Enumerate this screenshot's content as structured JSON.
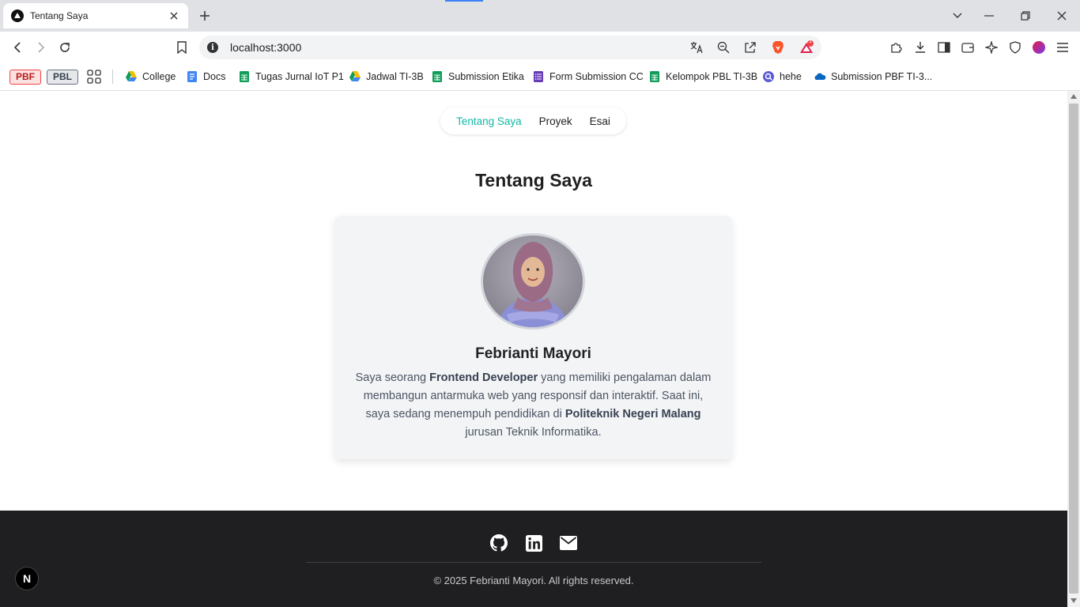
{
  "tab": {
    "title": "Tentang Saya"
  },
  "omnibox": {
    "url": "localhost:3000",
    "info_glyph": "i",
    "brave_badge": "1"
  },
  "bookmarks": {
    "pinned": [
      {
        "label": "PBF",
        "color": "#ef4444"
      },
      {
        "label": "PBL",
        "color": "#6b7280"
      }
    ],
    "items": [
      {
        "label": "College",
        "icon": "google-drive-icon"
      },
      {
        "label": "Docs",
        "icon": "google-docs-icon"
      },
      {
        "label": "Tugas Jurnal IoT P1",
        "icon": "google-sheets-icon"
      },
      {
        "label": "Jadwal TI-3B",
        "icon": "google-drive-icon"
      },
      {
        "label": "Submission Etika",
        "icon": "google-sheets-icon"
      },
      {
        "label": "Form Submission CC",
        "icon": "google-forms-icon"
      },
      {
        "label": "Kelompok PBL TI-3B",
        "icon": "google-sheets-icon"
      },
      {
        "label": "hehe",
        "icon": "search-app-icon"
      },
      {
        "label": "Submission PBF TI-3...",
        "icon": "onedrive-icon"
      }
    ]
  },
  "nav": {
    "links": [
      {
        "label": "Tentang Saya",
        "active": true
      },
      {
        "label": "Proyek",
        "active": false
      },
      {
        "label": "Esai",
        "active": false
      }
    ]
  },
  "main": {
    "heading": "Tentang Saya",
    "name": "Febrianti Mayori",
    "bio": {
      "p1": "Saya seorang ",
      "b1": "Frontend Developer",
      "p2": " yang memiliki pengalaman dalam membangun antarmuka web yang responsif dan interaktif. Saat ini, saya sedang menempuh pendidikan di ",
      "b2": "Politeknik Negeri Malang",
      "p3": " jurusan Teknik Informatika."
    }
  },
  "footer": {
    "icons": [
      "github-icon",
      "linkedin-icon",
      "email-icon"
    ],
    "copyright": "© 2025 Febrianti Mayori. All rights reserved."
  },
  "nextjs_badge": "N",
  "colors": {
    "accent": "#14b8a6",
    "footer_bg": "#1f1f22",
    "card_bg": "#f3f4f6"
  }
}
